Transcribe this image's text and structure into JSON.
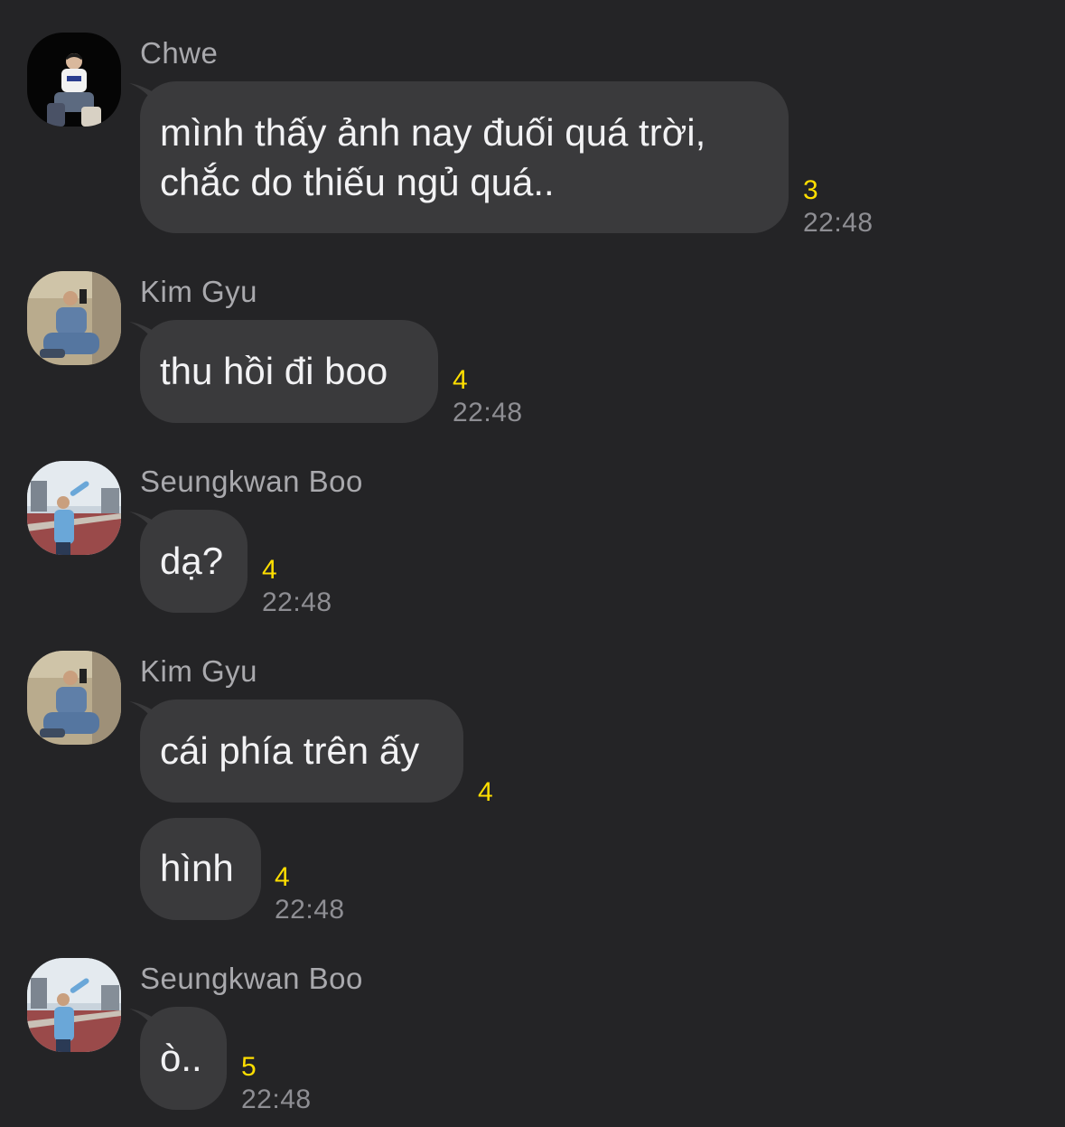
{
  "messages": [
    {
      "sender": "Chwe",
      "bubbles": [
        {
          "lines": [
            "mình thấy ảnh nay đuối quá trời,",
            "chắc do thiếu ngủ quá.."
          ],
          "unread": "3"
        }
      ],
      "time": "22:48"
    },
    {
      "sender": "Kim Gyu",
      "bubbles": [
        {
          "lines": [
            "thu hồi đi boo"
          ],
          "unread": "4"
        }
      ],
      "time": "22:48"
    },
    {
      "sender": "Seungkwan Boo",
      "bubbles": [
        {
          "lines": [
            "dạ?"
          ],
          "unread": "4"
        }
      ],
      "time": "22:48"
    },
    {
      "sender": "Kim Gyu",
      "bubbles": [
        {
          "lines": [
            "cái phía trên ấy"
          ],
          "unread": "4"
        },
        {
          "lines": [
            "hình"
          ],
          "unread": "4"
        }
      ],
      "time": "22:48"
    },
    {
      "sender": "Seungkwan Boo",
      "bubbles": [
        {
          "lines": [
            "ò.."
          ],
          "unread": "5"
        }
      ],
      "time": "22:48"
    }
  ]
}
